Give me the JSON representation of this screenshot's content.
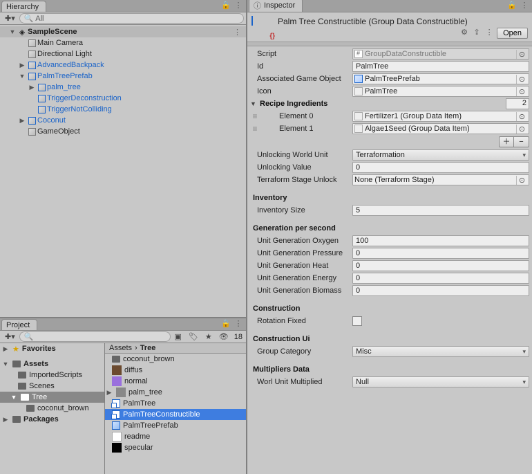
{
  "hierarchy": {
    "tab": "Hierarchy",
    "search_placeholder": "All",
    "scene": "SampleScene",
    "items": {
      "mainCamera": "Main Camera",
      "dirLight": "Directional Light",
      "advBackpack": "AdvancedBackpack",
      "palmPrefab": "PalmTreePrefab",
      "palmTree": "palm_tree",
      "triggerDecon": "TriggerDeconstruction",
      "triggerNotCol": "TriggerNotColliding",
      "coconut": "Coconut",
      "gameObject": "GameObject"
    }
  },
  "project": {
    "tab": "Project",
    "search_placeholder": "",
    "count": "18",
    "favorites": "Favorites",
    "assets": "Assets",
    "importedScripts": "ImportedScripts",
    "scenes": "Scenes",
    "treeFolder": "Tree",
    "coconutBrown": "coconut_brown",
    "packages": "Packages",
    "breadcrumb": [
      "Assets",
      "Tree"
    ],
    "files": {
      "coconut_brown": "coconut_brown",
      "diffus": "diffus",
      "normal": "normal",
      "palm_tree": "palm_tree",
      "palmTree": "PalmTree",
      "palmTreeConstructible": "PalmTreeConstructible",
      "palmTreePrefab": "PalmTreePrefab",
      "readme": "readme",
      "specular": "specular"
    }
  },
  "inspector": {
    "tab": "Inspector",
    "title": "Palm Tree Constructible (Group Data Constructible)",
    "open": "Open",
    "script_label": "Script",
    "script_value": "GroupDataConstructible",
    "id_label": "Id",
    "id_value": "PalmTree",
    "assocGO_label": "Associated Game Object",
    "assocGO_value": "PalmTreePrefab",
    "icon_label": "Icon",
    "icon_value": "PalmTree",
    "recipe_label": "Recipe Ingredients",
    "recipe_count": "2",
    "element0_label": "Element 0",
    "element0_value": "Fertilizer1 (Group Data Item)",
    "element1_label": "Element 1",
    "element1_value": "Algae1Seed (Group Data Item)",
    "unlockWorldUnit_label": "Unlocking World Unit",
    "unlockWorldUnit_value": "Terraformation",
    "unlockValue_label": "Unlocking Value",
    "unlockValue_value": "0",
    "terraStage_label": "Terraform Stage Unlock",
    "terraStage_value": "None (Terraform Stage)",
    "inventory_header": "Inventory",
    "inventorySize_label": "Inventory Size",
    "inventorySize_value": "5",
    "gen_header": "Generation per second",
    "genOxy_label": "Unit Generation Oxygen",
    "genOxy_value": "100",
    "genPres_label": "Unit Generation Pressure",
    "genPres_value": "0",
    "genHeat_label": "Unit Generation Heat",
    "genHeat_value": "0",
    "genEnergy_label": "Unit Generation Energy",
    "genEnergy_value": "0",
    "genBiomass_label": "Unit Generation Biomass",
    "genBiomass_value": "0",
    "construction_header": "Construction",
    "rotationFixed_label": "Rotation Fixed",
    "constructionUi_header": "Construction Ui",
    "groupCategory_label": "Group Category",
    "groupCategory_value": "Misc",
    "multipliers_header": "Multipliers Data",
    "worlUnitMult_label": "Worl Unit Multiplied",
    "worlUnitMult_value": "Null"
  }
}
